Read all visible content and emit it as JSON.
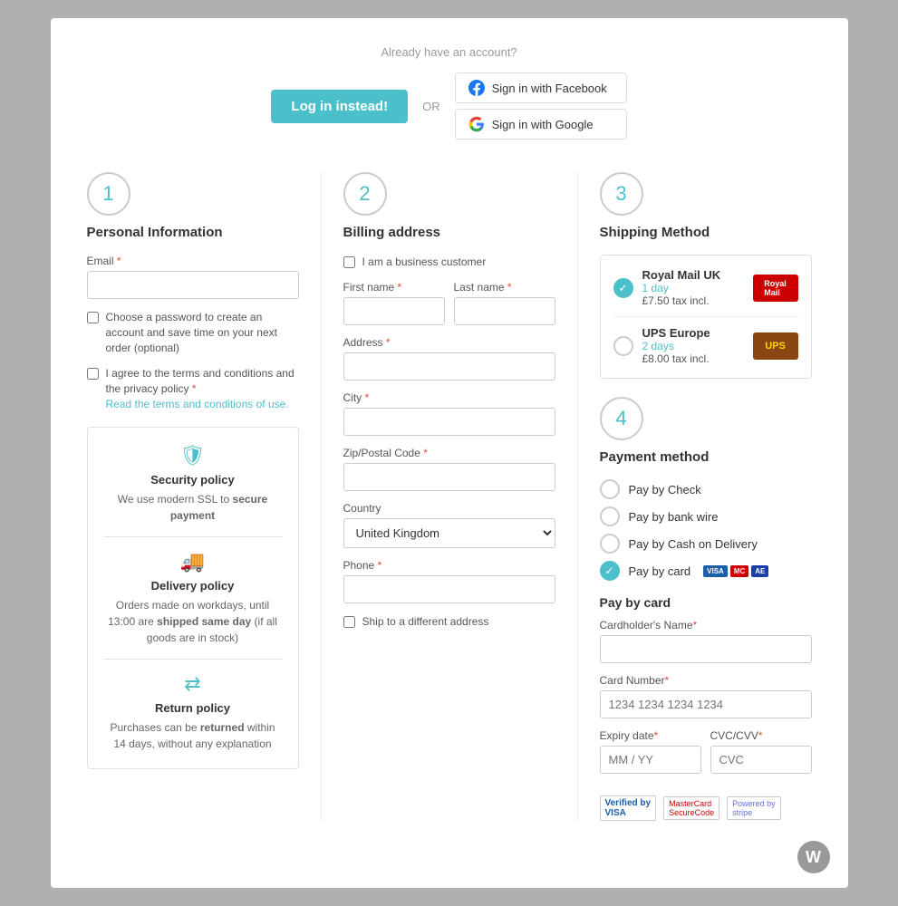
{
  "header": {
    "already_text": "Already have an account?",
    "login_btn": "Log in instead!",
    "or_text": "OR",
    "facebook_btn": "Sign in with Facebook",
    "google_btn": "Sign in with Google"
  },
  "steps": [
    {
      "number": "1",
      "title": "Personal Information"
    },
    {
      "number": "2",
      "title": "Billing address"
    },
    {
      "number": "3",
      "title": "Shipping Method"
    }
  ],
  "personal": {
    "email_label": "Email",
    "password_checkbox": "Choose a password to create an account and save time on your next order (optional)",
    "terms_checkbox": "I agree to the terms and conditions and the privacy policy",
    "terms_link": "Read the terms and conditions of use."
  },
  "billing": {
    "business_checkbox": "I am a business customer",
    "first_name_label": "First name",
    "last_name_label": "Last name",
    "address_label": "Address",
    "city_label": "City",
    "zip_label": "Zip/Postal Code",
    "country_label": "Country",
    "country_value": "United Kingdom",
    "phone_label": "Phone",
    "ship_different_checkbox": "Ship to a different address"
  },
  "shipping": {
    "options": [
      {
        "name": "Royal Mail UK",
        "days": "1 day",
        "price": "£7.50 tax incl.",
        "logo": "Royal Mail",
        "selected": true
      },
      {
        "name": "UPS Europe",
        "days": "2 days",
        "price": "£8.00 tax incl.",
        "logo": "UPS",
        "selected": false
      }
    ]
  },
  "payment": {
    "step_number": "4",
    "step_title": "Payment method",
    "options": [
      {
        "label": "Pay by Check",
        "selected": false
      },
      {
        "label": "Pay by bank wire",
        "selected": false
      },
      {
        "label": "Pay by Cash on Delivery",
        "selected": false
      },
      {
        "label": "Pay by card",
        "selected": true
      }
    ],
    "card_section_title": "Pay by card",
    "cardholder_label": "Cardholder's Name",
    "card_number_label": "Card Number",
    "card_number_placeholder": "1234 1234 1234 1234",
    "expiry_label": "Expiry date",
    "expiry_placeholder": "MM / YY",
    "cvc_label": "CVC/CVV",
    "cvc_placeholder": "CVC"
  },
  "policies": [
    {
      "title": "Security policy",
      "desc_plain": "We use modern SSL to ",
      "desc_bold": "secure payment",
      "icon": "shield"
    },
    {
      "title": "Delivery policy",
      "desc_plain1": "Orders made on workdays, until 13:00 are ",
      "desc_bold1": "shipped same day",
      "desc_plain2": " (if all goods are in stock)",
      "icon": "truck"
    },
    {
      "title": "Return policy",
      "desc_plain1": "Purchases can be ",
      "desc_bold1": "returned",
      "desc_plain2": " within 14 days, without any explanation",
      "icon": "return"
    }
  ]
}
